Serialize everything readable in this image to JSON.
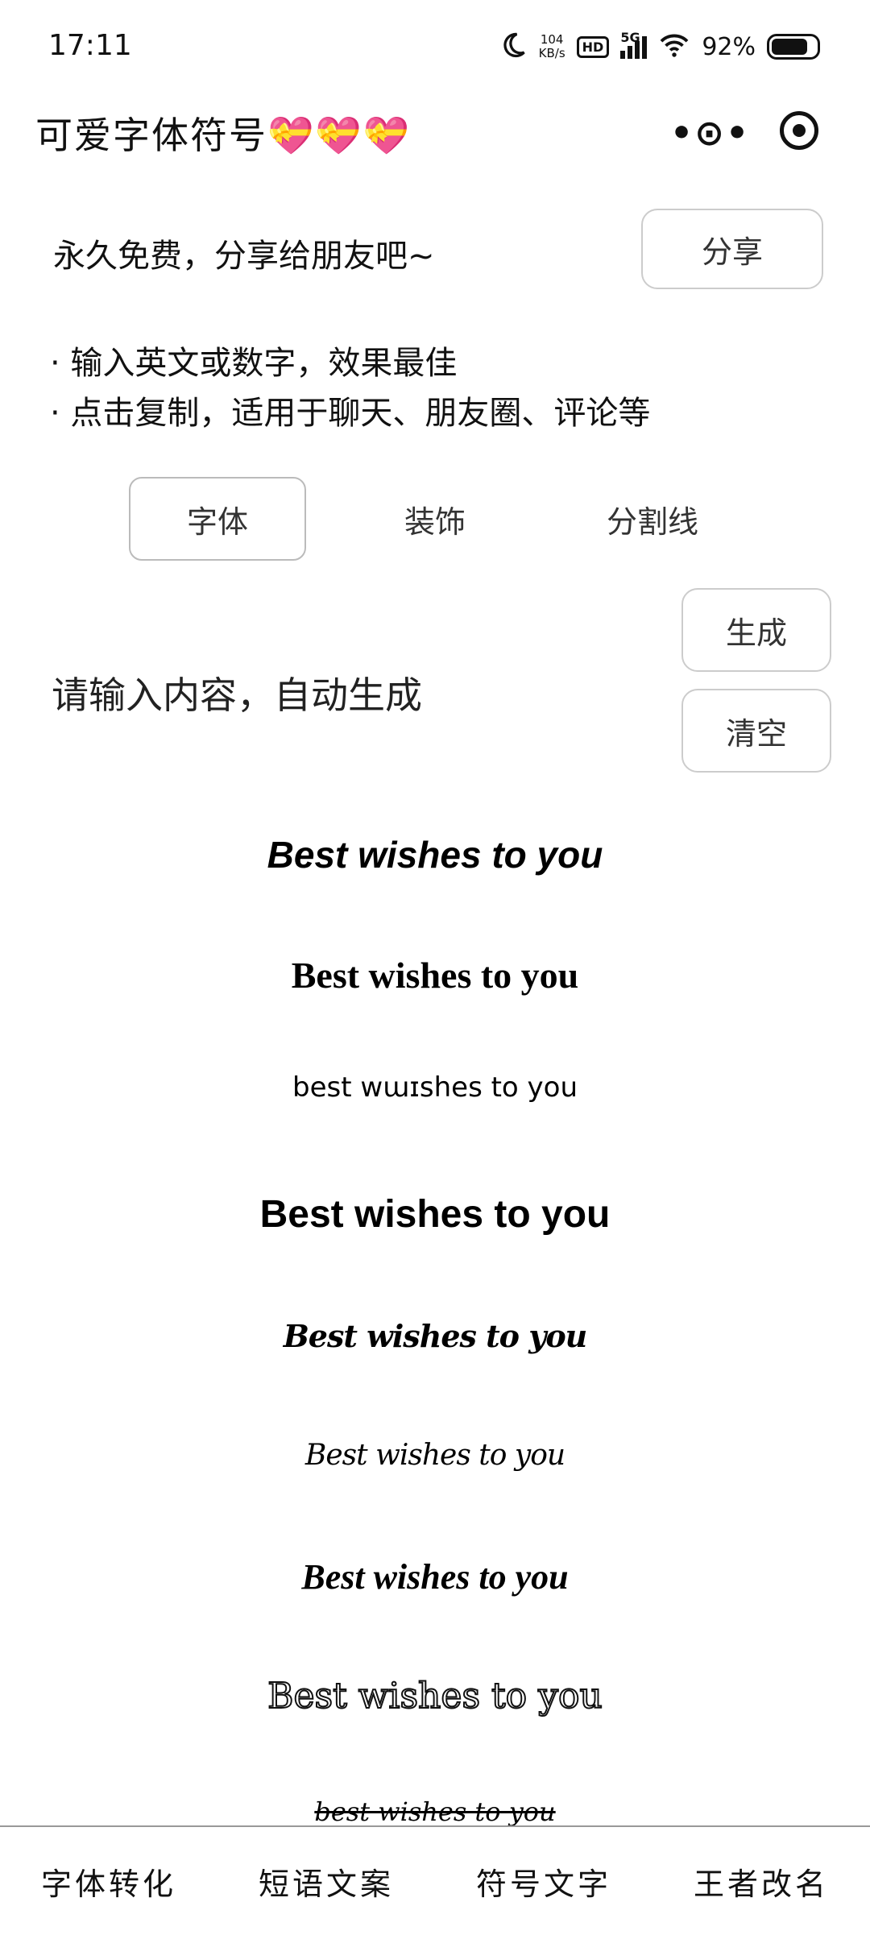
{
  "status": {
    "time": "17:11",
    "net_speed_value": "104",
    "net_speed_unit": "KB/s",
    "hd": "HD",
    "signal": "5G",
    "battery_percent": "92%",
    "battery_level": 0.92,
    "icons": [
      "moon-icon",
      "signal-icon",
      "wifi-icon",
      "battery-icon"
    ]
  },
  "nav": {
    "title": "可爱字体符号💝💝💝",
    "menu_label": "•⊙•"
  },
  "share": {
    "text": "永久免费，分享给朋友吧~",
    "button": "分享"
  },
  "tips": [
    "· 输入英文或数字，效果最佳",
    "· 点击复制，适用于聊天、朋友圈、评论等"
  ],
  "tabs": [
    {
      "label": "字体",
      "active": true
    },
    {
      "label": "装饰",
      "active": false
    },
    {
      "label": "分割线",
      "active": false
    }
  ],
  "input": {
    "placeholder": "请输入内容，自动生成",
    "generate_button": "生成",
    "clear_button": "清空"
  },
  "results": [
    "Best wishes to you",
    "Best wishes to you",
    "best wɯɪshes to you",
    "Best wishes to you",
    "Best wishes to you",
    "Best wishes to you",
    "Best wishes to you",
    "Best wishes to you",
    "best wishes to you"
  ],
  "tab_bar": [
    "字体转化",
    "短语文案",
    "符号文字",
    "王者改名"
  ]
}
